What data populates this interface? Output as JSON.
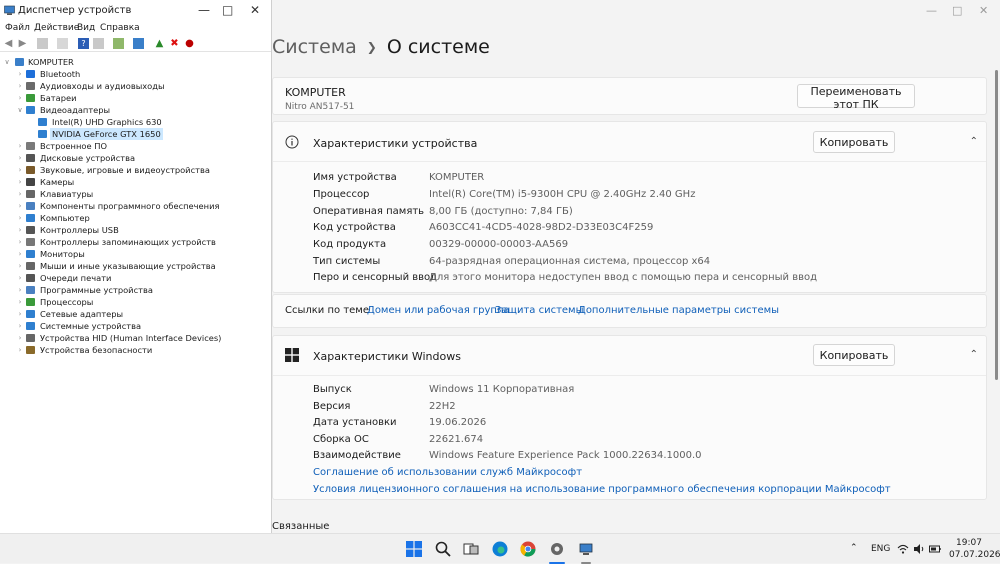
{
  "settings": {
    "breadcrumb": {
      "parent": "Система",
      "current": "О системе"
    },
    "device_header": {
      "name": "KOMPUTER",
      "model": "Nitro AN517-51",
      "rename_button": "Переименовать этот ПК"
    },
    "device_specs": {
      "title": "Характеристики устройства",
      "copy_button": "Копировать",
      "rows": [
        {
          "key": "Имя устройства",
          "value": "KOMPUTER"
        },
        {
          "key": "Процессор",
          "value": "Intel(R) Core(TM) i5-9300H CPU @ 2.40GHz   2.40 GHz"
        },
        {
          "key": "Оперативная память",
          "value": "8,00 ГБ (доступно: 7,84 ГБ)"
        },
        {
          "key": "Код устройства",
          "value": "A603CC41-4CD5-4028-98D2-D33E03C4F259"
        },
        {
          "key": "Код продукта",
          "value": "00329-00000-00003-AA569"
        },
        {
          "key": "Тип системы",
          "value": "64-разрядная операционная система, процессор x64"
        },
        {
          "key": "Перо и сенсорный ввод",
          "value": "Для этого монитора недоступен ввод с помощью пера и сенсорный ввод"
        }
      ]
    },
    "related_links": {
      "label": "Ссылки по теме",
      "links": [
        "Домен или рабочая группа",
        "Защита системы",
        "Дополнительные параметры системы"
      ]
    },
    "windows_specs": {
      "title": "Характеристики Windows",
      "copy_button": "Копировать",
      "rows": [
        {
          "key": "Выпуск",
          "value": "Windows 11 Корпоративная"
        },
        {
          "key": "Версия",
          "value": "22H2"
        },
        {
          "key": "Дата установки",
          "value": "19.06.2026"
        },
        {
          "key": "Сборка ОС",
          "value": "22621.674"
        },
        {
          "key": "Взаимодействие",
          "value": "Windows Feature Experience Pack 1000.22634.1000.0"
        }
      ],
      "links": [
        "Соглашение об использовании служб Майкрософт",
        "Условия лицензионного соглашения на использование программного обеспечения корпорации Майкрософт"
      ]
    },
    "related_heading": "Связанные"
  },
  "devmgr": {
    "title": "Диспетчер устройств",
    "menu": [
      "Файл",
      "Действие",
      "Вид",
      "Справка"
    ],
    "root": "KOMPUTER",
    "nodes": [
      {
        "label": "Bluetooth",
        "color": "#1e6fd9"
      },
      {
        "label": "Аудиовходы и аудиовыходы",
        "color": "#6b6b6b"
      },
      {
        "label": "Батареи",
        "color": "#3a9a3a"
      },
      {
        "label": "Видеоадаптеры",
        "color": "#2f7fcf"
      },
      {
        "label": "Intel(R) UHD Graphics 630",
        "color": "#2f7fcf"
      },
      {
        "label": "NVIDIA GeForce GTX 1650",
        "color": "#2f7fcf"
      },
      {
        "label": "Встроенное ПО",
        "color": "#7a7a7a"
      },
      {
        "label": "Дисковые устройства",
        "color": "#555555"
      },
      {
        "label": "Звуковые, игровые и видеоустройства",
        "color": "#7a5a2a"
      },
      {
        "label": "Камеры",
        "color": "#444444"
      },
      {
        "label": "Клавиатуры",
        "color": "#666666"
      },
      {
        "label": "Компоненты программного обеспечения",
        "color": "#4a80c0"
      },
      {
        "label": "Компьютер",
        "color": "#2f7fcf"
      },
      {
        "label": "Контроллеры USB",
        "color": "#555555"
      },
      {
        "label": "Контроллеры запоминающих устройств",
        "color": "#777777"
      },
      {
        "label": "Мониторы",
        "color": "#2f7fcf"
      },
      {
        "label": "Мыши и иные указывающие устройства",
        "color": "#666666"
      },
      {
        "label": "Очереди печати",
        "color": "#555555"
      },
      {
        "label": "Программные устройства",
        "color": "#4a80c0"
      },
      {
        "label": "Процессоры",
        "color": "#3a9a3a"
      },
      {
        "label": "Сетевые адаптеры",
        "color": "#2f7fcf"
      },
      {
        "label": "Системные устройства",
        "color": "#2f7fcf"
      },
      {
        "label": "Устройства HID (Human Interface Devices)",
        "color": "#666666"
      },
      {
        "label": "Устройства безопасности",
        "color": "#8a6a2a"
      }
    ]
  },
  "taskbar": {
    "lang": "ENG",
    "time": "19:07",
    "date": "07.07.2026"
  }
}
